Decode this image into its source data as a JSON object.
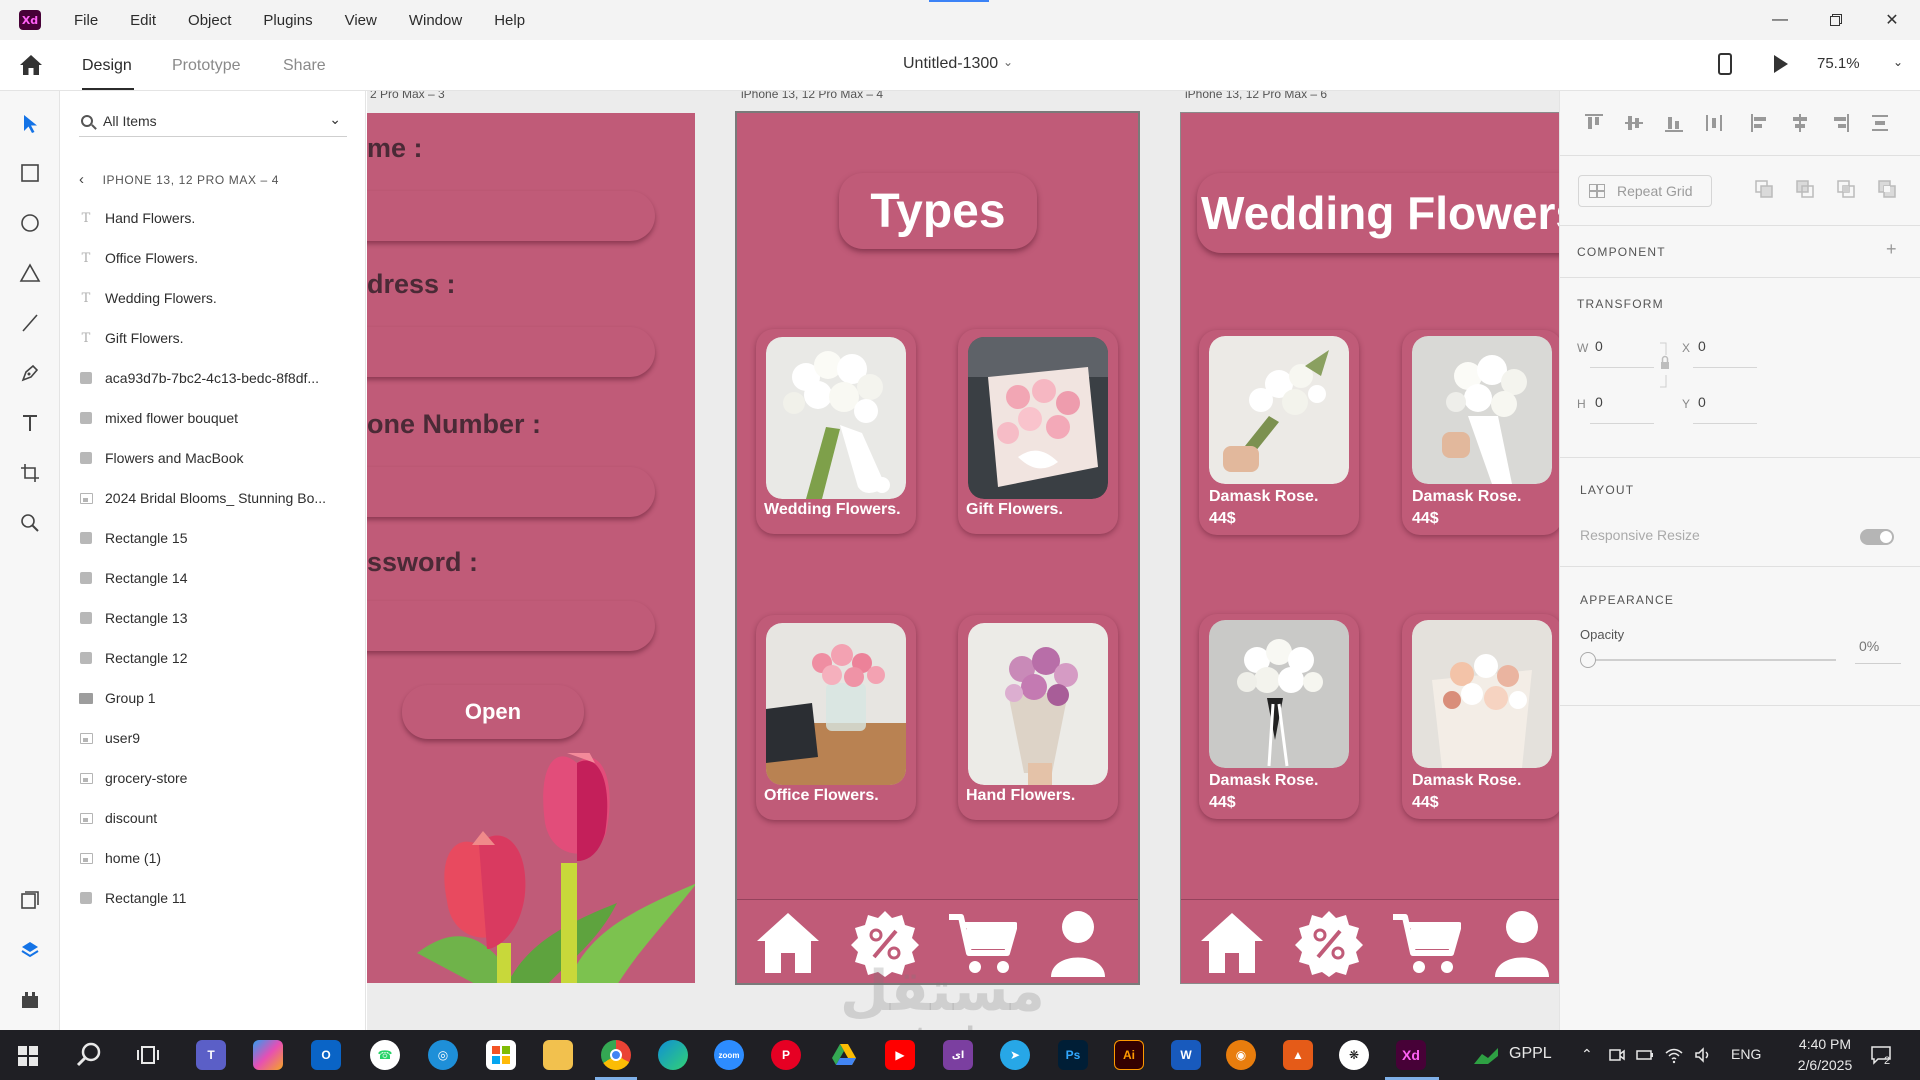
{
  "app": {
    "logo_text": "Xd",
    "accent": "#470137"
  },
  "menu": [
    "File",
    "Edit",
    "Object",
    "Plugins",
    "View",
    "Window",
    "Help"
  ],
  "tabs": {
    "design": "Design",
    "prototype": "Prototype",
    "share": "Share"
  },
  "document": {
    "title": "Untitled-1300"
  },
  "zoom": "75.1%",
  "layers": {
    "search_placeholder": "All Items",
    "breadcrumb": "IPHONE 13, 12 PRO MAX – 4",
    "items": [
      {
        "label": "Hand Flowers.",
        "kind": "text"
      },
      {
        "label": "Office Flowers.",
        "kind": "text"
      },
      {
        "label": "Wedding Flowers.",
        "kind": "text"
      },
      {
        "label": "Gift Flowers.",
        "kind": "text"
      },
      {
        "label": "aca93d7b-7bc2-4c13-bedc-8f8df...",
        "kind": "rect"
      },
      {
        "label": "mixed flower bouquet",
        "kind": "rect"
      },
      {
        "label": "Flowers and MacBook",
        "kind": "rect"
      },
      {
        "label": "2024 Bridal Blooms_ Stunning Bo...",
        "kind": "image"
      },
      {
        "label": "Rectangle 15",
        "kind": "rect"
      },
      {
        "label": "Rectangle 14",
        "kind": "rect"
      },
      {
        "label": "Rectangle 13",
        "kind": "rect"
      },
      {
        "label": "Rectangle 12",
        "kind": "rect"
      },
      {
        "label": "Group 1",
        "kind": "folder"
      },
      {
        "label": "user9",
        "kind": "image"
      },
      {
        "label": "grocery-store",
        "kind": "image"
      },
      {
        "label": "discount",
        "kind": "image"
      },
      {
        "label": "home (1)",
        "kind": "image"
      },
      {
        "label": "Rectangle 11",
        "kind": "rect"
      }
    ]
  },
  "artboards": {
    "signup": {
      "label": "2 Pro Max – 3",
      "fields": [
        "me :",
        "dress :",
        "one Number :",
        "ssword :"
      ],
      "button": "Open"
    },
    "types": {
      "label": "iPhone 13, 12 Pro Max – 4",
      "heading": "Types",
      "cards": [
        "Wedding Flowers.",
        "Gift Flowers.",
        "Office Flowers.",
        "Hand Flowers."
      ]
    },
    "wedding": {
      "label": "iPhone 13, 12 Pro Max – 6",
      "heading": "Wedding Flowers",
      "products": [
        {
          "name": "Damask Rose.",
          "price": "44$"
        },
        {
          "name": "Damask Rose.",
          "price": "44$"
        },
        {
          "name": "Damask Rose.",
          "price": "44$"
        },
        {
          "name": "Damask Rose.",
          "price": "44$"
        }
      ]
    },
    "artboard_color": "#c05b78"
  },
  "watermark": {
    "arabic": "مستقل",
    "latin": "mostaql.com"
  },
  "properties": {
    "repeat_grid": "Repeat Grid",
    "component": "COMPONENT",
    "transform": "TRANSFORM",
    "w_label": "W",
    "w_value": "0",
    "x_label": "X",
    "x_value": "0",
    "h_label": "H",
    "h_value": "0",
    "y_label": "Y",
    "y_value": "0",
    "layout": "LAYOUT",
    "responsive_resize": "Responsive Resize",
    "appearance": "APPEARANCE",
    "opacity_label": "Opacity",
    "opacity_value": "0%"
  },
  "taskbar": {
    "gppl": "GPPL",
    "lang": "ENG",
    "time": "4:40 PM",
    "date": "2/6/2025",
    "notification_count": "2"
  }
}
